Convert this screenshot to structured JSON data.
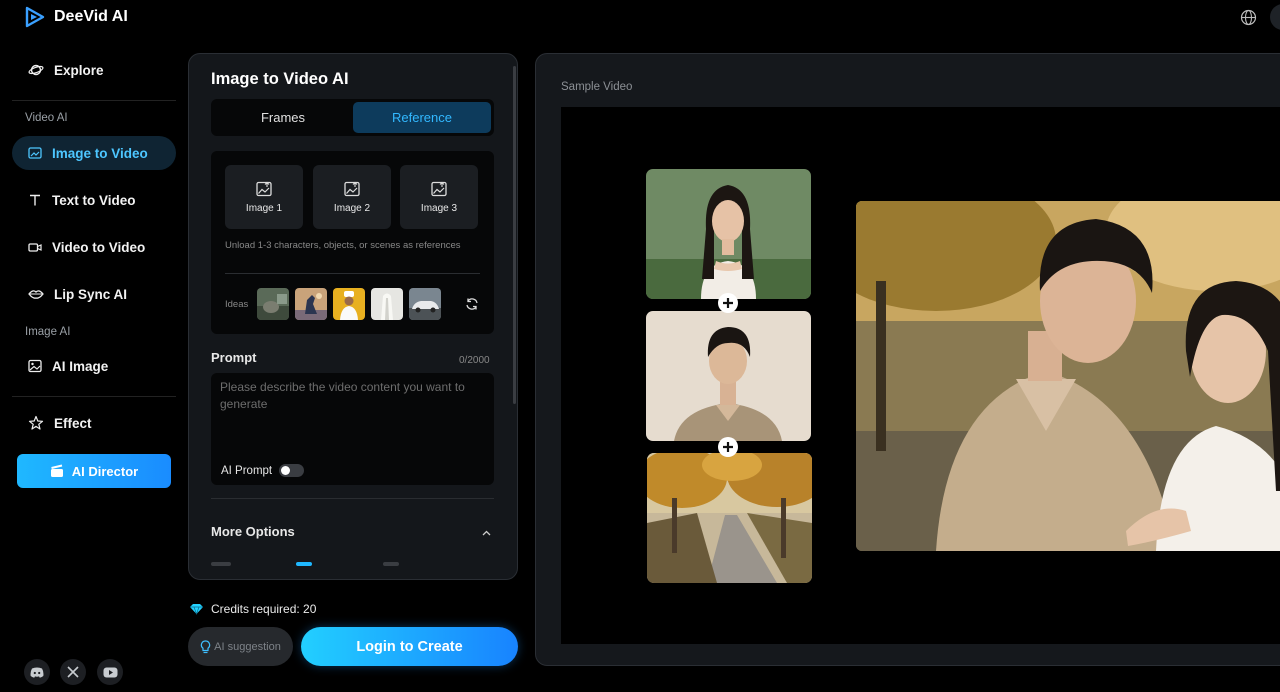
{
  "app": {
    "name": "DeeVid AI"
  },
  "sidebar": {
    "explore": "Explore",
    "video_section": "Video AI",
    "image_to_video": "Image to Video",
    "text_to_video": "Text to Video",
    "video_to_video": "Video to Video",
    "lip_sync": "Lip Sync AI",
    "image_section": "Image AI",
    "ai_image": "AI Image",
    "effect": "Effect",
    "ai_director": "AI Director"
  },
  "form": {
    "title": "Image to Video AI",
    "tabs": {
      "frames": "Frames",
      "reference": "Reference",
      "active": "reference"
    },
    "slots": {
      "image1": "Image 1",
      "image2": "Image 2",
      "image3": "Image 3"
    },
    "upload_hint": "Unload 1-3 characters, objects, or scenes as references",
    "ideas_label": "Ideas",
    "prompt": {
      "label": "Prompt",
      "count": "0/2000",
      "placeholder": "Please describe the video content you want to generate",
      "value": ""
    },
    "ai_prompt": {
      "label": "AI Prompt",
      "enabled": false
    },
    "more_options": "More Options"
  },
  "actions": {
    "credits": "Credits required: 20",
    "ai_suggestion": "AI suggestion",
    "login_create": "Login to Create"
  },
  "sample": {
    "label": "Sample Video"
  },
  "colors": {
    "accent": "#1FB8FF",
    "active_tab_bg": "#0D3B5C",
    "active_tab_text": "#32B8FF",
    "panel_bg": "#14171B"
  },
  "icons": {
    "logo": "play-triangle-icon",
    "explore": "planet-icon",
    "image_to_video": "image-frame-icon",
    "text_to_video": "text-t-icon",
    "video_to_video": "video-camera-icon",
    "lip_sync": "lips-icon",
    "ai_image": "image-icon",
    "effect": "sparkle-star-icon",
    "ai_director": "clapperboard-icon",
    "globe": "globe-icon",
    "credits": "diamond-icon",
    "ai_suggestion": "lightbulb-icon",
    "refresh": "refresh-icon",
    "upload": "image-upload-icon",
    "chevron": "chevron-up-icon",
    "discord": "discord-icon",
    "x": "x-icon",
    "youtube": "youtube-icon"
  }
}
